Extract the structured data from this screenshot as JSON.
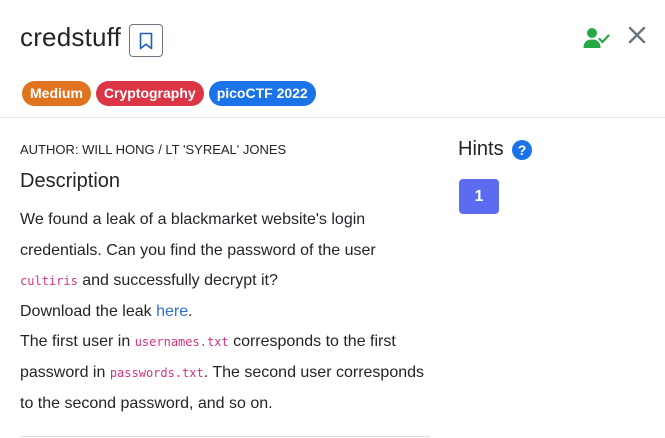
{
  "challenge": {
    "title": "credstuff",
    "tags": {
      "difficulty": "Medium",
      "category": "Cryptography",
      "event": "picoCTF 2022"
    },
    "author": "AUTHOR: WILL HONG / LT 'SYREAL' JONES",
    "description_heading": "Description",
    "description": {
      "p1_a": "We found a leak of a blackmarket website's login credentials. Can you find the password of the user ",
      "p1_code": "cultiris",
      "p1_b": " and successfully decrypt it?",
      "p2_a": "Download the leak ",
      "p2_link": "here",
      "p2_b": ".",
      "p3_a": "The first user in ",
      "p3_code1": "usernames.txt",
      "p3_b": " corresponds to the first password in ",
      "p3_code2": "passwords.txt",
      "p3_c": ". The second user corresponds to the second password, and so on."
    }
  },
  "hints": {
    "title": "Hints",
    "buttons": [
      "1"
    ]
  },
  "icons": {
    "bookmark": "bookmark-icon",
    "solved": "user-check-icon",
    "close": "close-icon",
    "help": "question-circle-icon"
  },
  "colors": {
    "difficulty_tag": "#e0731f",
    "category_tag": "#dc3545",
    "event_tag": "#1a73e8",
    "hint_button": "#5b6cf0",
    "solved_icon": "#28a745",
    "link": "#2f6fd6",
    "code": "#d63384"
  }
}
